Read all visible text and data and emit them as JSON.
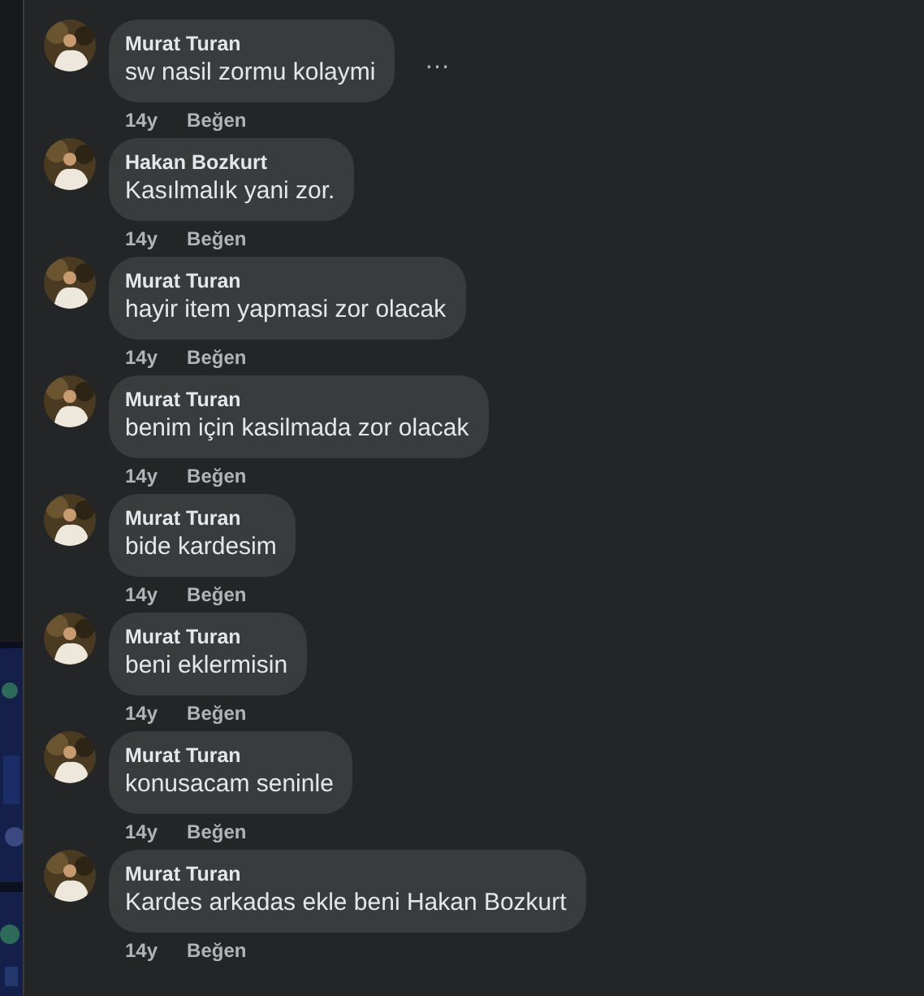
{
  "comments": [
    {
      "author": "Murat Turan",
      "text": "sw nasil zormu kolaymi",
      "time": "14y",
      "like": "Beğen",
      "menu": "…"
    },
    {
      "author": "Hakan Bozkurt",
      "text": "Kasılmalık yani zor.",
      "time": "14y",
      "like": "Beğen"
    },
    {
      "author": "Murat Turan",
      "text": "hayir item yapmasi zor olacak",
      "time": "14y",
      "like": "Beğen"
    },
    {
      "author": "Murat Turan",
      "text": "benim için kasilmada zor olacak",
      "time": "14y",
      "like": "Beğen"
    },
    {
      "author": "Murat Turan",
      "text": "bide kardesim",
      "time": "14y",
      "like": "Beğen"
    },
    {
      "author": "Murat Turan",
      "text": "beni eklermisin",
      "time": "14y",
      "like": "Beğen"
    },
    {
      "author": "Murat Turan",
      "text": "konusacam seninle",
      "time": "14y",
      "like": "Beğen"
    },
    {
      "author": "Murat Turan",
      "text": "Kardes arkadas ekle beni Hakan Bozkurt",
      "time": "14y",
      "like": "Beğen"
    }
  ]
}
